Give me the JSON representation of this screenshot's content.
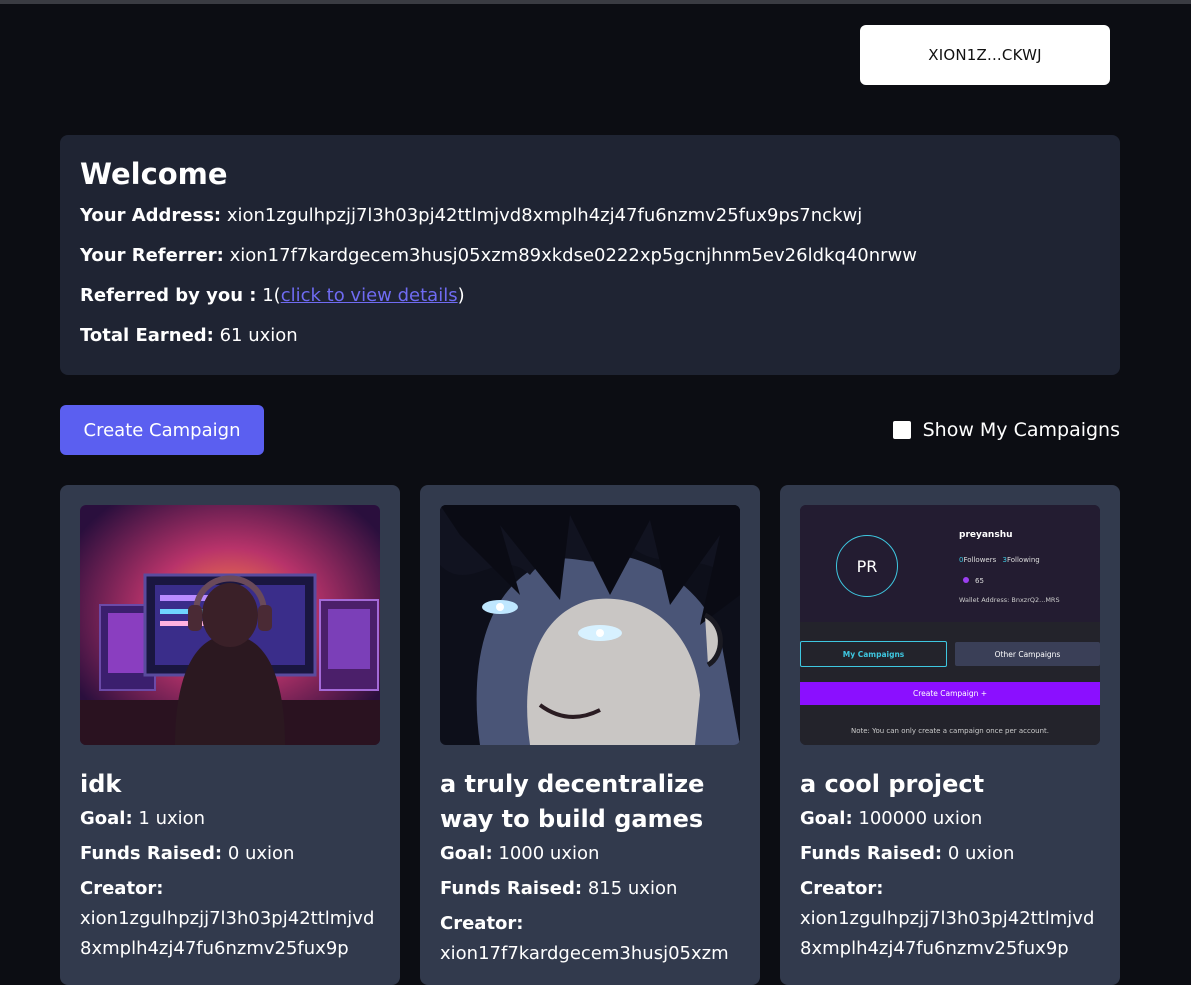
{
  "wallet": {
    "label": "XION1Z...CKWJ"
  },
  "welcome": {
    "title": "Welcome",
    "address_label": "Your Address:",
    "address": "xion1zgulhpzjj7l3h03pj42ttlmjvd8xmplh4zj47fu6nzmv25fux9ps7nckwj",
    "referrer_label": "Your Referrer:",
    "referrer": "xion17f7kardgecem3husj05xzm89xkdse0222xp5gcnjhnm5ev26ldkq40nrww",
    "referred_label": "Referred by you :",
    "referred_count": "1(",
    "referred_link": "click to view details",
    "referred_close": ")",
    "earned_label": "Total Earned:",
    "earned_value": "61 uxion"
  },
  "actions": {
    "create_label": "Create Campaign",
    "show_mine_label": "Show My Campaigns"
  },
  "labels": {
    "goal": "Goal:",
    "funds": "Funds Raised:",
    "creator": "Creator:"
  },
  "campaigns": [
    {
      "title": "idk",
      "goal": "1 uxion",
      "funds": "0 uxion",
      "creator": "xion1zgulhpzjj7l3h03pj42ttlmjvd8xmplh4zj47fu6nzmv25fux9p"
    },
    {
      "title": "a truly decentralize way to build games",
      "goal": "1000 uxion",
      "funds": "815 uxion",
      "creator": "xion17f7kardgecem3husj05xzm"
    },
    {
      "title": "a cool project",
      "goal": "100000 uxion",
      "funds": "0 uxion",
      "creator": "xion1zgulhpzjj7l3h03pj42ttlmjvd8xmplh4zj47fu6nzmv25fux9p"
    }
  ],
  "profile_shot": {
    "initials": "PR",
    "name": "preyanshu",
    "followers_count": "0",
    "followers_label": "Followers",
    "following_count": "3",
    "following_label": "Following",
    "score": "65",
    "wallet": "Wallet Address: BnxzrQ2...MRS",
    "tab_mine": "My Campaigns",
    "tab_other": "Other Campaigns",
    "create": "Create Campaign +",
    "note": "Note: You can only create a campaign once per account."
  }
}
